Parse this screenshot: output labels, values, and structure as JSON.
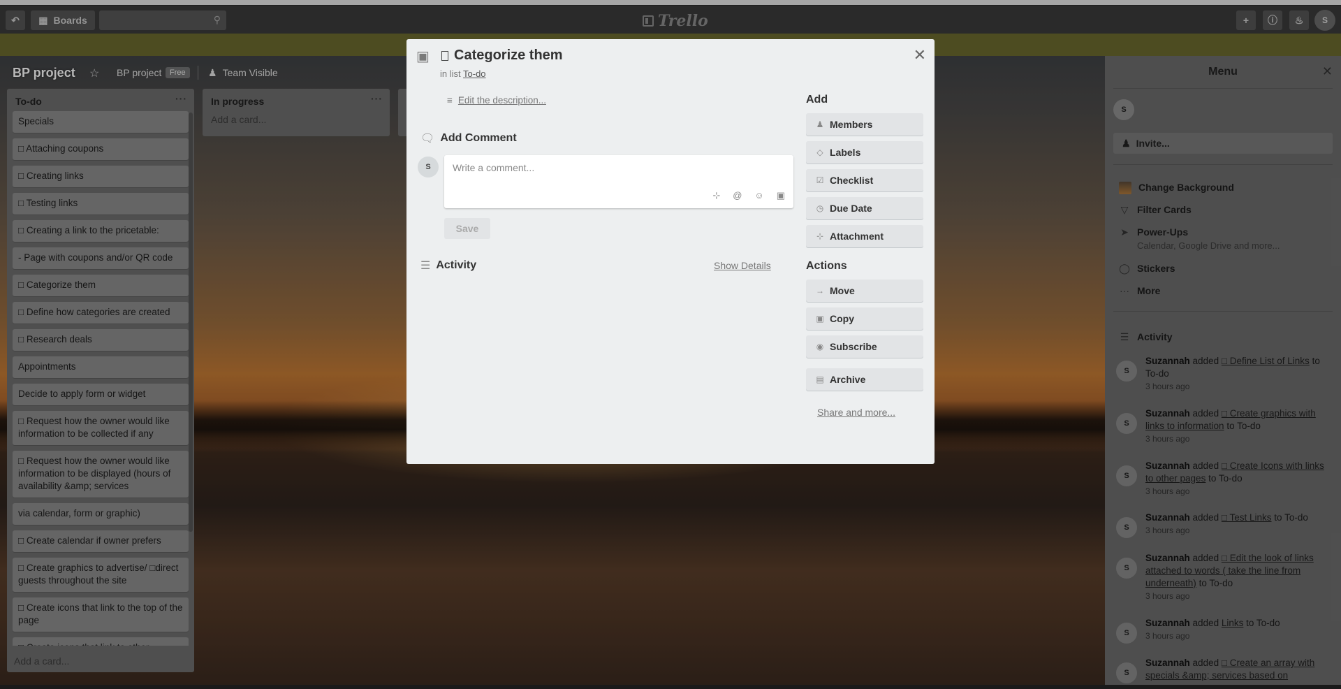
{
  "header": {
    "boards_label": "Boards",
    "logo_text": "Trello",
    "avatar_initial": "S"
  },
  "board": {
    "title": "BP project",
    "org_name": "BP project",
    "org_badge": "Free",
    "visibility": "Team Visible"
  },
  "lists": [
    {
      "name": "To-do",
      "cards": [
        "Specials",
        "□ Attaching coupons",
        "□ Creating links",
        "□ Testing links",
        "□ Creating a link to the pricetable:",
        "- Page with coupons and/or QR code",
        "□ Categorize them",
        "□ Define how categories are created",
        "□ Research deals",
        "Appointments",
        "Decide to apply form or widget",
        "□ Request how the owner would like information to be collected if any",
        "□ Request how the owner would like information to be displayed (hours of availability &amp; services",
        "via calendar, form or graphic)",
        "□ Create calendar if owner prefers",
        "□ Create graphics to advertise/ □direct guests throughout the site",
        "□ Create icons that link to the top of the page",
        "□ Create icons that link to other"
      ],
      "add_card": "Add a card..."
    },
    {
      "name": "In progress",
      "add_card": "Add a card..."
    }
  ],
  "modal": {
    "title": "Categorize them",
    "in_list_prefix": "in list",
    "in_list_name": "To-do",
    "edit_description": "Edit the description...",
    "add_comment_heading": "Add Comment",
    "comment_avatar": "S",
    "comment_placeholder": "Write a comment...",
    "save_label": "Save",
    "activity_heading": "Activity",
    "show_details": "Show Details",
    "add_heading": "Add",
    "add_buttons": [
      "Members",
      "Labels",
      "Checklist",
      "Due Date",
      "Attachment"
    ],
    "actions_heading": "Actions",
    "action_buttons": [
      "Move",
      "Copy",
      "Subscribe"
    ],
    "archive_label": "Archive",
    "share_label": "Share and more..."
  },
  "menu": {
    "title": "Menu",
    "avatar": "S",
    "invite_label": "Invite...",
    "items": [
      {
        "label": "Change Background"
      },
      {
        "label": "Filter Cards"
      },
      {
        "label": "Power-Ups",
        "sub": "Calendar, Google Drive and more..."
      },
      {
        "label": "Stickers"
      },
      {
        "label": "More"
      }
    ],
    "activity_heading": "Activity",
    "activity": [
      {
        "user": "Suzannah",
        "verb": "added",
        "card": "□ Define List of Links",
        "dest": "to To-do",
        "time": "3 hours ago"
      },
      {
        "user": "Suzannah",
        "verb": "added",
        "card": "□ Create graphics with links to information",
        "dest": "to To-do",
        "time": "3 hours ago"
      },
      {
        "user": "Suzannah",
        "verb": "added",
        "card": "□ Create Icons with links to other pages",
        "dest": "to To-do",
        "time": "3 hours ago"
      },
      {
        "user": "Suzannah",
        "verb": "added",
        "card": "□ Test Links",
        "dest": "to To-do",
        "time": "3 hours ago"
      },
      {
        "user": "Suzannah",
        "verb": "added",
        "card": "□ Edit the look of links attached to words ( take the line from underneath)",
        "dest": "to To-do",
        "time": "3 hours ago"
      },
      {
        "user": "Suzannah",
        "verb": "added",
        "card": "Links",
        "dest": "to To-do",
        "time": "3 hours ago"
      },
      {
        "user": "Suzannah",
        "verb": "added",
        "card": "□ Create an array with specials &amp; services based on",
        "dest": "",
        "time": ""
      }
    ]
  }
}
